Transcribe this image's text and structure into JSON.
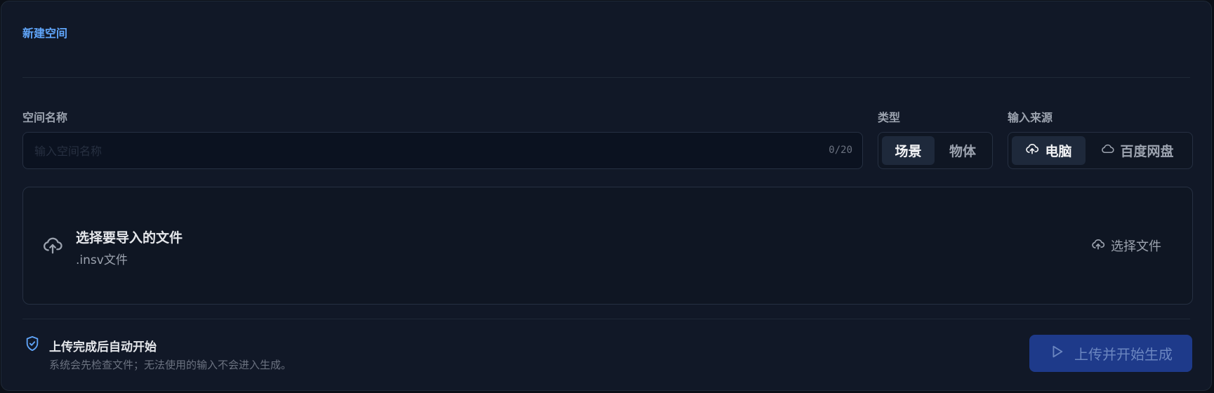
{
  "panel": {
    "title": "新建空间"
  },
  "name_field": {
    "label": "空间名称",
    "value": "",
    "placeholder": "输入空间名称",
    "count": "0/20"
  },
  "type_field": {
    "label": "类型",
    "options": [
      "场景",
      "物体"
    ],
    "selected": "场景"
  },
  "source_field": {
    "label": "输入来源",
    "options": [
      "电脑",
      "百度网盘"
    ],
    "selected": "电脑",
    "option_icons": [
      "cloud-upload-icon",
      "cloud-icon"
    ]
  },
  "dropzone": {
    "title": "选择要导入的文件",
    "subtitle": ".insv文件",
    "button_label": "选择文件",
    "icon": "cloud-upload-icon"
  },
  "footer": {
    "title": "上传完成后自动开始",
    "subtitle": "系统会先检查文件；无法使用的输入不会进入生成。",
    "icon": "shield-check-icon",
    "primary_button_label": "上传并开始生成",
    "primary_button_icon": "play-icon"
  },
  "colors": {
    "accent": "#60a5fa",
    "panel_bg": "#111827",
    "primary_button_bg": "#1e3a8a"
  }
}
